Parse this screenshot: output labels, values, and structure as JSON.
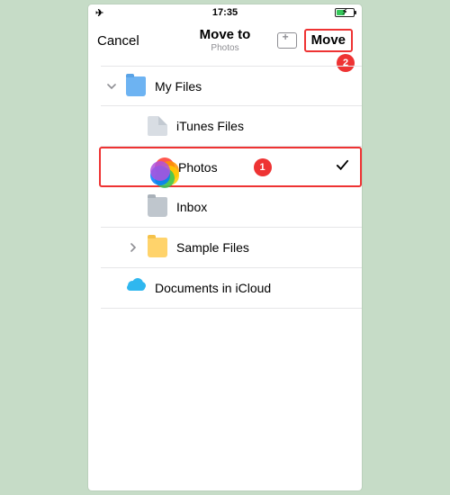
{
  "status": {
    "time": "17:35"
  },
  "nav": {
    "cancel": "Cancel",
    "title": "Move to",
    "subtitle": "Photos",
    "move": "Move"
  },
  "list": {
    "my_files": "My Files",
    "itunes": "iTunes Files",
    "photos": "Photos",
    "inbox": "Inbox",
    "sample": "Sample Files",
    "icloud": "Documents in iCloud"
  },
  "callouts": {
    "one": "1",
    "two": "2"
  }
}
